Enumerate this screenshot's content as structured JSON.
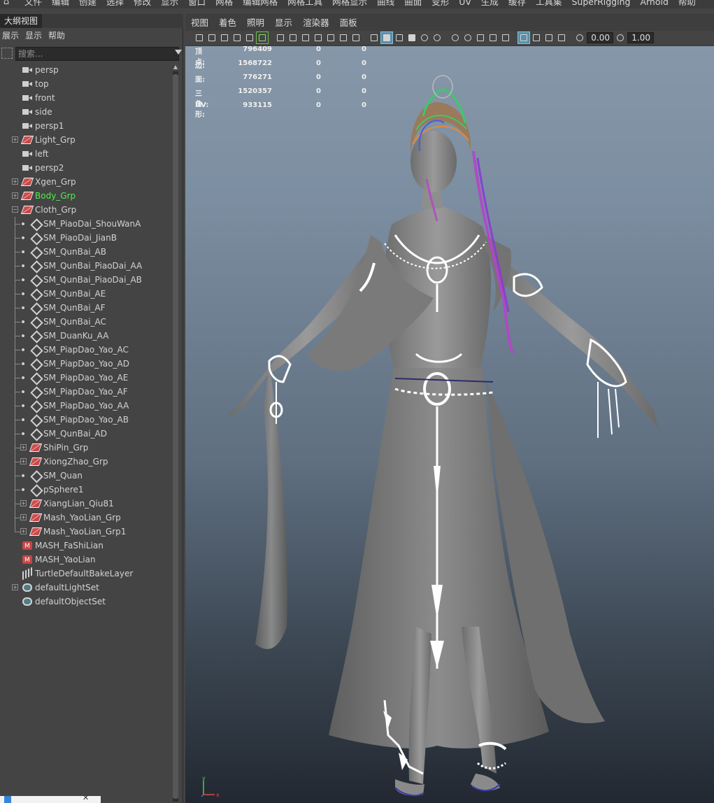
{
  "menubar": {
    "items": [
      "文件",
      "编辑",
      "创建",
      "选择",
      "修改",
      "显示",
      "窗口",
      "网格",
      "编辑网格",
      "网格工具",
      "网格显示",
      "曲线",
      "曲面",
      "变形",
      "UV",
      "生成",
      "缓存",
      "工具集",
      "SuperRigging",
      "Arnold",
      "帮助"
    ]
  },
  "outliner": {
    "tab_title": "大纲视图",
    "menu": [
      "展示",
      "显示",
      "帮助"
    ],
    "search_placeholder": "搜索...",
    "items": [
      {
        "label": "persp",
        "icon": "camera-icon",
        "depth": 0,
        "expand": false
      },
      {
        "label": "top",
        "icon": "camera-icon",
        "depth": 0,
        "expand": false
      },
      {
        "label": "front",
        "icon": "camera-icon",
        "depth": 0,
        "expand": false
      },
      {
        "label": "side",
        "icon": "camera-icon",
        "depth": 0,
        "expand": false
      },
      {
        "label": "persp1",
        "icon": "camera-icon",
        "depth": 0,
        "expand": false
      },
      {
        "label": "Light_Grp",
        "icon": "group-icon",
        "depth": 0,
        "expand": "+"
      },
      {
        "label": "left",
        "icon": "camera-icon",
        "depth": 0,
        "expand": false
      },
      {
        "label": "persp2",
        "icon": "camera-icon",
        "depth": 0,
        "expand": false
      },
      {
        "label": "Xgen_Grp",
        "icon": "group-icon",
        "depth": 0,
        "expand": "+"
      },
      {
        "label": "Body_Grp",
        "icon": "group-icon",
        "depth": 0,
        "expand": "+",
        "color": "#4ef04e"
      },
      {
        "label": "Cloth_Grp",
        "icon": "group-icon",
        "depth": 0,
        "expand": "-"
      },
      {
        "label": "SM_PiaoDai_ShouWanA",
        "icon": "mesh-icon",
        "depth": 1,
        "expand": false
      },
      {
        "label": "SM_PiaoDai_JianB",
        "icon": "mesh-icon",
        "depth": 1,
        "expand": false
      },
      {
        "label": "SM_QunBai_AB",
        "icon": "mesh-icon",
        "depth": 1,
        "expand": false
      },
      {
        "label": "SM_QunBai_PiaoDai_AA",
        "icon": "mesh-icon",
        "depth": 1,
        "expand": false
      },
      {
        "label": "SM_QunBai_PiaoDai_AB",
        "icon": "mesh-icon",
        "depth": 1,
        "expand": false
      },
      {
        "label": "SM_QunBai_AE",
        "icon": "mesh-icon",
        "depth": 1,
        "expand": false
      },
      {
        "label": "SM_QunBai_AF",
        "icon": "mesh-icon",
        "depth": 1,
        "expand": false
      },
      {
        "label": "SM_QunBai_AC",
        "icon": "mesh-icon",
        "depth": 1,
        "expand": false
      },
      {
        "label": "SM_DuanKu_AA",
        "icon": "mesh-icon",
        "depth": 1,
        "expand": false
      },
      {
        "label": "SM_PiapDao_Yao_AC",
        "icon": "mesh-icon",
        "depth": 1,
        "expand": false
      },
      {
        "label": "SM_PiapDao_Yao_AD",
        "icon": "mesh-icon",
        "depth": 1,
        "expand": false
      },
      {
        "label": "SM_PiapDao_Yao_AE",
        "icon": "mesh-icon",
        "depth": 1,
        "expand": false
      },
      {
        "label": "SM_PiapDao_Yao_AF",
        "icon": "mesh-icon",
        "depth": 1,
        "expand": false
      },
      {
        "label": "SM_PiapDao_Yao_AA",
        "icon": "mesh-icon",
        "depth": 1,
        "expand": false
      },
      {
        "label": "SM_PiapDao_Yao_AB",
        "icon": "mesh-icon",
        "depth": 1,
        "expand": false
      },
      {
        "label": "SM_QunBai_AD",
        "icon": "mesh-icon",
        "depth": 1,
        "expand": false
      },
      {
        "label": "ShiPin_Grp",
        "icon": "group-icon",
        "depth": 1,
        "expand": "+"
      },
      {
        "label": "XiongZhao_Grp",
        "icon": "group-icon",
        "depth": 1,
        "expand": "+"
      },
      {
        "label": "SM_Quan",
        "icon": "mesh-icon",
        "depth": 1,
        "expand": false
      },
      {
        "label": "pSphere1",
        "icon": "mesh-icon",
        "depth": 1,
        "expand": false
      },
      {
        "label": "XiangLian_Qiu81",
        "icon": "group-icon",
        "depth": 1,
        "expand": "+"
      },
      {
        "label": "Mash_YaoLian_Grp",
        "icon": "group-icon",
        "depth": 1,
        "expand": "+"
      },
      {
        "label": "Mash_YaoLian_Grp1",
        "icon": "group-icon",
        "depth": 1,
        "expand": "+",
        "last": true
      },
      {
        "label": "MASH_FaShiLian",
        "icon": "mash-icon",
        "depth": 0,
        "expand": false
      },
      {
        "label": "MASH_YaoLian",
        "icon": "mash-icon",
        "depth": 0,
        "expand": false
      },
      {
        "label": "TurtleDefaultBakeLayer",
        "icon": "turtle-icon",
        "depth": 0,
        "expand": false
      },
      {
        "label": "defaultLightSet",
        "icon": "set-icon",
        "depth": 0,
        "expand": "+"
      },
      {
        "label": "defaultObjectSet",
        "icon": "set-icon",
        "depth": 0,
        "expand": false
      }
    ]
  },
  "viewport": {
    "menu": [
      "视图",
      "着色",
      "照明",
      "显示",
      "渲染器",
      "面板"
    ],
    "toolbar": {
      "field1": "0.00",
      "field2": "1.00"
    },
    "hud": [
      {
        "label": "顶点:",
        "v1": "796409",
        "v2": "0",
        "v3": "0"
      },
      {
        "label": "边:",
        "v1": "1568722",
        "v2": "0",
        "v3": "0"
      },
      {
        "label": "面:",
        "v1": "776271",
        "v2": "0",
        "v3": "0"
      },
      {
        "label": "三角形:",
        "v1": "1520357",
        "v2": "0",
        "v3": "0"
      },
      {
        "label": "UV:",
        "v1": "933115",
        "v2": "0",
        "v3": "0"
      }
    ],
    "axis": {
      "y": "y",
      "x": "x"
    }
  },
  "colors": {
    "selected_text": "#4ef04e",
    "panel_bg": "#444444",
    "viewport_top": "#8597a8",
    "viewport_bottom": "#222831"
  }
}
